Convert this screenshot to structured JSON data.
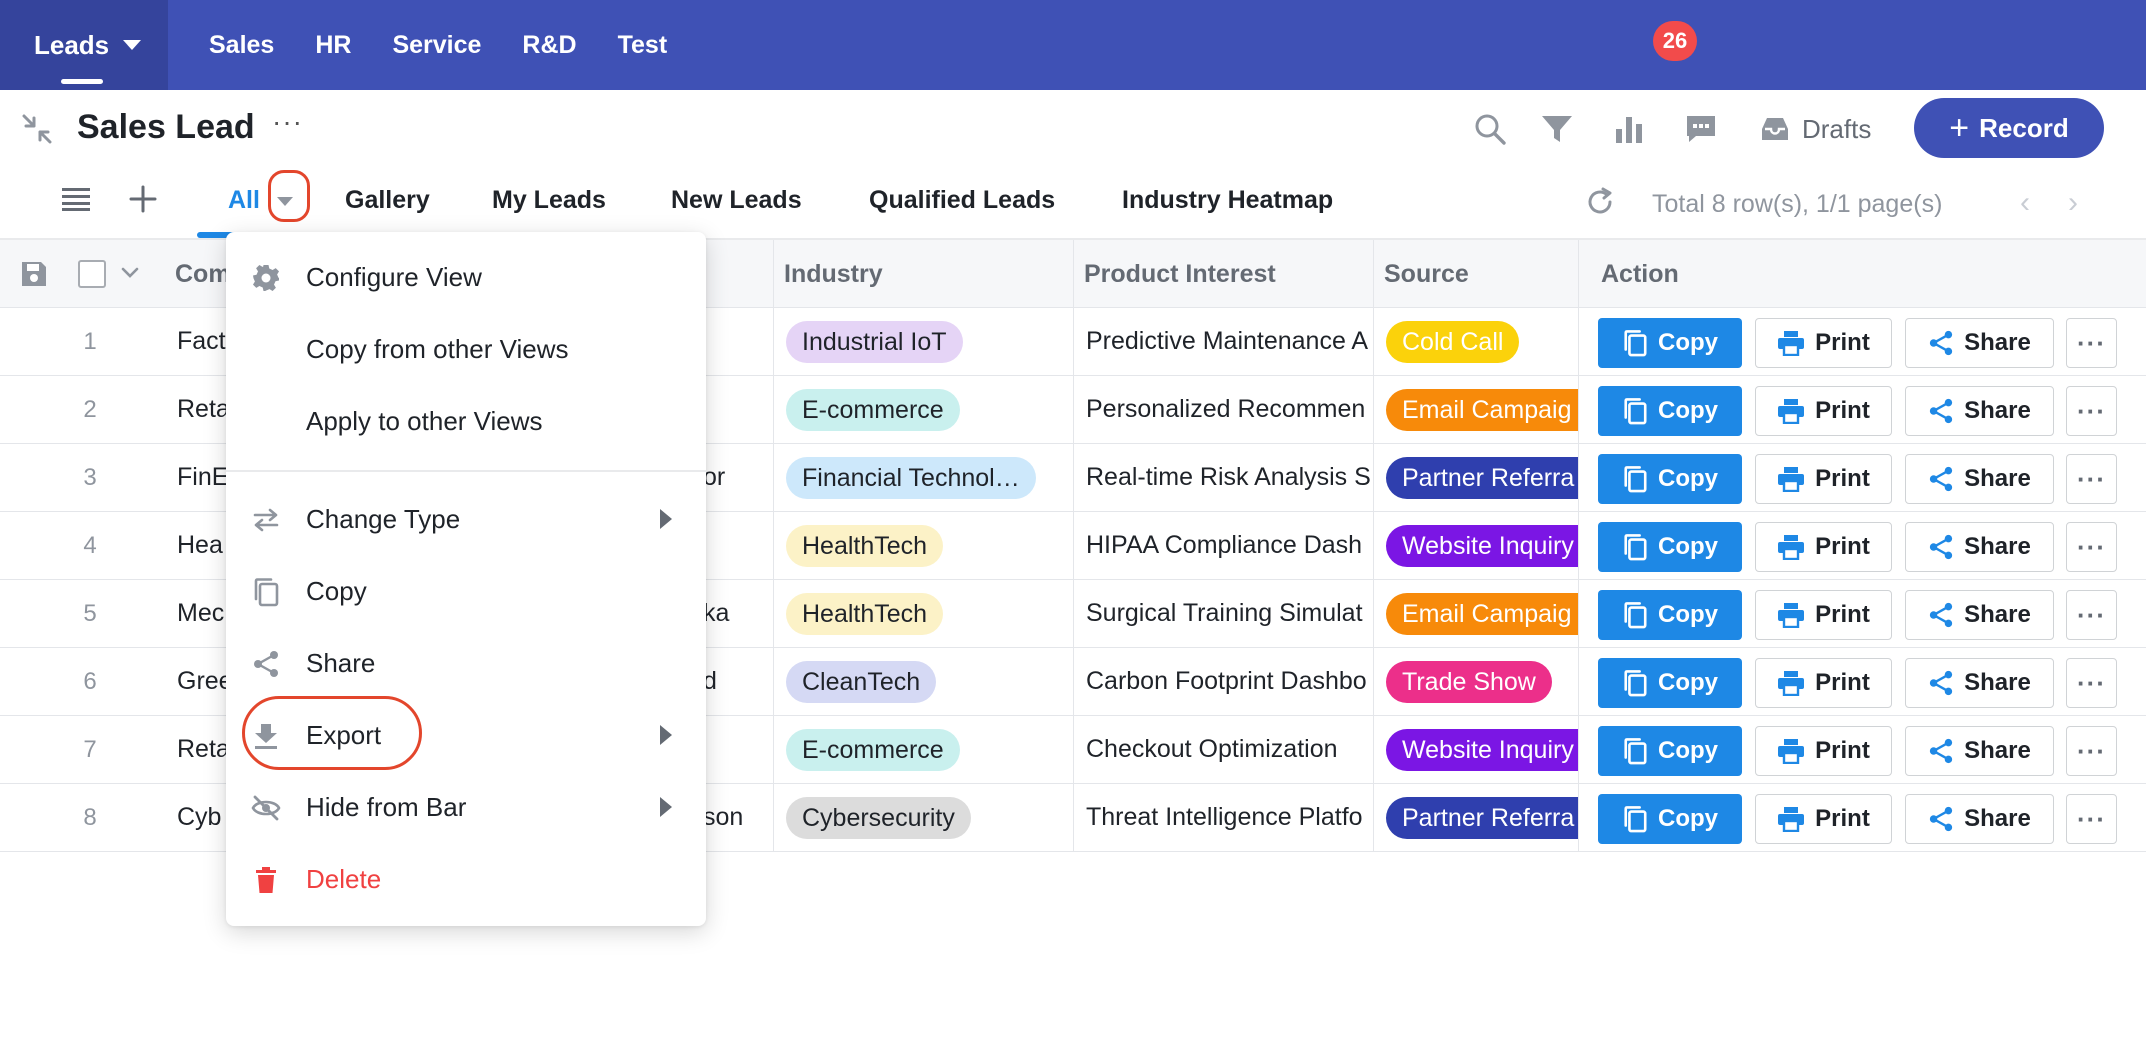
{
  "nav": {
    "apps": [
      {
        "label": "Leads"
      },
      {
        "label": "Sales"
      },
      {
        "label": "HR"
      },
      {
        "label": "Service"
      },
      {
        "label": "R&D"
      },
      {
        "label": "Test"
      }
    ],
    "todo_count": "26",
    "icons": [
      "task-check-icon",
      "ai-sparkle-icon",
      "team-icon",
      "globe-icon",
      "search-icon",
      "help-icon"
    ]
  },
  "header": {
    "title": "Sales Lead",
    "more": "···",
    "drafts_label": "Drafts",
    "record_label": "Record",
    "record_plus": "+"
  },
  "views": {
    "tabs": [
      "All",
      "Gallery",
      "My Leads",
      "New Leads",
      "Qualified Leads",
      "Industry Heatmap"
    ],
    "active": "All",
    "pager_text": "Total 8 row(s), 1/1 page(s)",
    "prev": "‹",
    "next": "›"
  },
  "table": {
    "headers": {
      "company": "Com",
      "industry": "Industry",
      "product": "Product Interest",
      "source": "Source",
      "action": "Action"
    },
    "rows": [
      {
        "num": "1",
        "company": "Fact",
        "contact": "",
        "industry": "Industrial IoT",
        "industry_color": "#e5d4f6",
        "product": "Predictive Maintenance A",
        "source": "Cold Call",
        "source_color": "#fbd20b",
        "source_round": true
      },
      {
        "num": "2",
        "company": "Reta",
        "contact": "",
        "industry": "E-commerce",
        "industry_color": "#c9f0ee",
        "product": "Personalized Recommen",
        "source": "Email Campaig",
        "source_color": "#f78a0a",
        "source_round": false
      },
      {
        "num": "3",
        "company": "FinE",
        "contact": "or",
        "industry": "Financial Technol…",
        "industry_color": "#cde8fb",
        "product": "Real-time Risk Analysis S",
        "source": "Partner Referra",
        "source_color": "#2f3fae",
        "source_round": false
      },
      {
        "num": "4",
        "company": "Hea",
        "contact": "",
        "industry": "HealthTech",
        "industry_color": "#fcf2c7",
        "product": "HIPAA Compliance Dash",
        "source": "Website Inquiry",
        "source_color": "#7b16e4",
        "source_round": false
      },
      {
        "num": "5",
        "company": "Mec",
        "contact": "ka",
        "industry": "HealthTech",
        "industry_color": "#fcf2c7",
        "product": "Surgical Training Simulat",
        "source": "Email Campaig",
        "source_color": "#f78a0a",
        "source_round": false
      },
      {
        "num": "6",
        "company": "Gree",
        "contact": "d",
        "industry": "CleanTech",
        "industry_color": "#d5d9f4",
        "product": "Carbon Footprint Dashbo",
        "source": "Trade Show",
        "source_color": "#ec2f8a",
        "source_round": true
      },
      {
        "num": "7",
        "company": "Reta",
        "contact": "",
        "industry": "E-commerce",
        "industry_color": "#c9f0ee",
        "product": "Checkout Optimization",
        "source": "Website Inquiry",
        "source_color": "#7b16e4",
        "source_round": false
      },
      {
        "num": "8",
        "company": "Cyb",
        "contact": "son",
        "industry": "Cybersecurity",
        "industry_color": "#dcdcdc",
        "product": "Threat Intelligence Platfo",
        "source": "Partner Referra",
        "source_color": "#2f3fae",
        "source_round": false
      }
    ],
    "actions": {
      "copy": "Copy",
      "print": "Print",
      "share": "Share",
      "more": "···"
    }
  },
  "menu": {
    "items": [
      {
        "label": "Configure View",
        "icon": "gear-icon"
      },
      {
        "label": "Copy from other Views",
        "icon": ""
      },
      {
        "label": "Apply to other Views",
        "icon": ""
      },
      {
        "label": "Change Type",
        "icon": "swap-icon",
        "submenu": true
      },
      {
        "label": "Copy",
        "icon": "copy-icon"
      },
      {
        "label": "Share",
        "icon": "share-icon"
      },
      {
        "label": "Export",
        "icon": "download-icon",
        "submenu": true
      },
      {
        "label": "Hide from Bar",
        "icon": "eye-off-icon",
        "submenu": true
      },
      {
        "label": "Delete",
        "icon": "trash-icon",
        "danger": true
      }
    ]
  },
  "colors": {
    "nav_bg": "#3f51b5",
    "accent": "#1e88e5",
    "danger": "#f04141",
    "annotation_ring": "#e3462c"
  }
}
